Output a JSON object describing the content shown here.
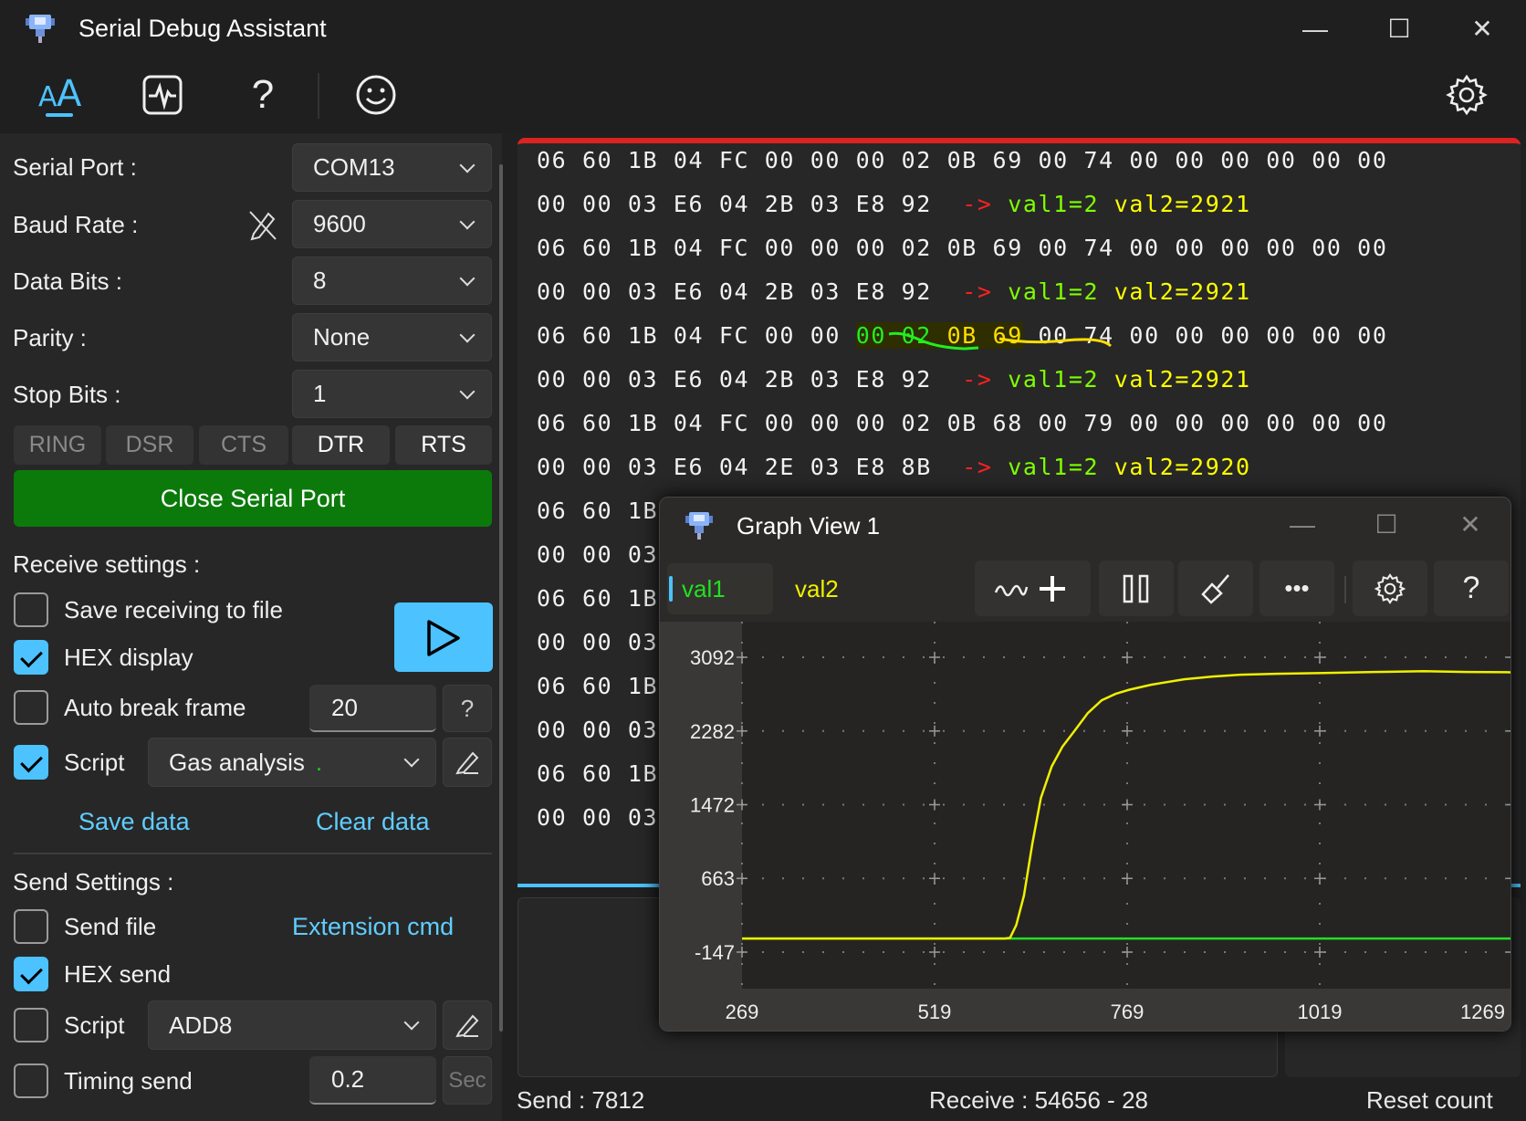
{
  "window": {
    "title": "Serial Debug Assistant",
    "minimize": "—",
    "maximize": "☐",
    "close": "✕"
  },
  "toolbar": {
    "help": "?"
  },
  "serial": {
    "port_label": "Serial Port :",
    "port_value": "COM13",
    "baud_label": "Baud Rate :",
    "baud_value": "9600",
    "databits_label": "Data Bits :",
    "databits_value": "8",
    "parity_label": "Parity :",
    "parity_value": "None",
    "stopbits_label": "Stop Bits :",
    "stopbits_value": "1",
    "signals": [
      {
        "label": "RING",
        "active": false
      },
      {
        "label": "DSR",
        "active": false
      },
      {
        "label": "CTS",
        "active": false
      },
      {
        "label": "DTR",
        "active": true
      },
      {
        "label": "RTS",
        "active": true
      }
    ],
    "close_button": "Close Serial Port",
    "close_button_color": "#0b7a0b"
  },
  "receive": {
    "heading": "Receive settings :",
    "save_to_file": {
      "label": "Save receiving to file",
      "checked": false
    },
    "hex_display": {
      "label": "HEX display",
      "checked": true
    },
    "auto_break": {
      "label": "Auto break frame",
      "checked": false,
      "value": "20",
      "help": "?"
    },
    "script": {
      "label": "Script",
      "checked": true,
      "value": "Gas analysis",
      "status_dot": "."
    },
    "save_data": "Save data",
    "clear_data": "Clear data"
  },
  "send": {
    "heading": "Send Settings :",
    "send_file": {
      "label": "Send file",
      "checked": false
    },
    "extension_cmd": "Extension cmd",
    "hex_send": {
      "label": "HEX send",
      "checked": true
    },
    "script": {
      "label": "Script",
      "checked": false,
      "value": "ADD8"
    },
    "timing": {
      "label": "Timing send",
      "checked": false,
      "value": "0.2",
      "unit": "Sec"
    }
  },
  "received_lines": [
    [
      {
        "t": "06 60 1B 04 FC 00 00 00 02 0B 69 00 74 00 00 00 00 00 00",
        "c": "#f2f2f2"
      }
    ],
    [
      {
        "t": "00 00 03 E6 04 2B 03 E8 92  ",
        "c": "#f2f2f2"
      },
      {
        "t": "-> ",
        "c": "#ff2020"
      },
      {
        "t": "val1=2 ",
        "c": "#7fff00"
      },
      {
        "t": "val2=2921",
        "c": "#ffff00"
      }
    ],
    [
      {
        "t": "06 60 1B 04 FC 00 00 00 02 0B 69 00 74 00 00 00 00 00 00",
        "c": "#f2f2f2"
      }
    ],
    [
      {
        "t": "00 00 03 E6 04 2B 03 E8 92  ",
        "c": "#f2f2f2"
      },
      {
        "t": "-> ",
        "c": "#ff2020"
      },
      {
        "t": "val1=2 ",
        "c": "#7fff00"
      },
      {
        "t": "val2=2921",
        "c": "#ffff00"
      }
    ],
    [
      {
        "t": "06 60 1B 04 FC 00 00 ",
        "c": "#f2f2f2"
      },
      {
        "t": "00 02 ",
        "c": "#22ee22",
        "bg": "#2e2e00"
      },
      {
        "t": "0B 69",
        "c": "#ffdd00",
        "bg": "#2e2e00"
      },
      {
        "t": " 00 74 00 00 00 00 00 00",
        "c": "#f2f2f2"
      }
    ],
    [
      {
        "t": "00 00 03 E6 04 2B 03 E8 92  ",
        "c": "#f2f2f2"
      },
      {
        "t": "-> ",
        "c": "#ff2020"
      },
      {
        "t": "val1=2 ",
        "c": "#7fff00"
      },
      {
        "t": "val2=2921",
        "c": "#ffff00"
      }
    ],
    [
      {
        "t": "06 60 1B 04 FC 00 00 00 02 0B 68 00 79 00 00 00 00 00 00",
        "c": "#f2f2f2"
      }
    ],
    [
      {
        "t": "00 00 03 E6 04 2E 03 E8 8B  ",
        "c": "#f2f2f2"
      },
      {
        "t": "-> ",
        "c": "#ff2020"
      },
      {
        "t": "val1=2 ",
        "c": "#7fff00"
      },
      {
        "t": "val2=2920",
        "c": "#ffff00"
      }
    ],
    [
      {
        "t": "06 60 1B",
        "c": "#f2f2f2"
      }
    ],
    [
      {
        "t": "00 00 03",
        "c": "#f2f2f2"
      }
    ],
    [
      {
        "t": "06 60 1B",
        "c": "#f2f2f2"
      }
    ],
    [
      {
        "t": "00 00 03",
        "c": "#f2f2f2"
      }
    ],
    [
      {
        "t": "06 60 1B",
        "c": "#f2f2f2"
      }
    ],
    [
      {
        "t": "00 00 03",
        "c": "#f2f2f2"
      }
    ],
    [
      {
        "t": "06 60 1B",
        "c": "#f2f2f2"
      }
    ],
    [
      {
        "t": "00 00 03",
        "c": "#f2f2f2"
      }
    ]
  ],
  "graph": {
    "title": "Graph View 1",
    "minimize": "—",
    "maximize": "☐",
    "close": "✕",
    "tabs": [
      {
        "label": "val1",
        "color": "#22e022",
        "selected": true
      },
      {
        "label": "val2",
        "color": "#f0f000",
        "selected": false
      }
    ],
    "help": "?"
  },
  "chart_data": {
    "type": "line",
    "x_ticks": [
      269,
      519,
      769,
      1019,
      1269
    ],
    "y_ticks": [
      3092,
      2282,
      1472,
      663,
      -147
    ],
    "xlim": [
      269,
      1269
    ],
    "ylim": [
      -147,
      3092
    ],
    "grid": true,
    "series": [
      {
        "name": "val1",
        "color": "#22e022",
        "x": [
          269,
          1269
        ],
        "y": [
          2,
          2
        ]
      },
      {
        "name": "val2",
        "color": "#f0f000",
        "x": [
          269,
          610,
          617,
          625,
          635,
          646,
          657,
          671,
          685,
          700,
          718,
          736,
          754,
          772,
          800,
          843,
          880,
          916,
          970,
          1024,
          1090,
          1154,
          1210,
          1269
        ],
        "y": [
          2,
          2,
          10,
          150,
          474,
          1049,
          1547,
          1892,
          2110,
          2276,
          2480,
          2620,
          2690,
          2736,
          2790,
          2850,
          2880,
          2900,
          2912,
          2919,
          2930,
          2939,
          2930,
          2927
        ]
      }
    ]
  },
  "status": {
    "send_label": "Send :",
    "send_count": "7812",
    "receive_label": "Receive :",
    "receive_count": "54656",
    "separator": "-",
    "receive_extra": "28",
    "reset": "Reset count"
  }
}
